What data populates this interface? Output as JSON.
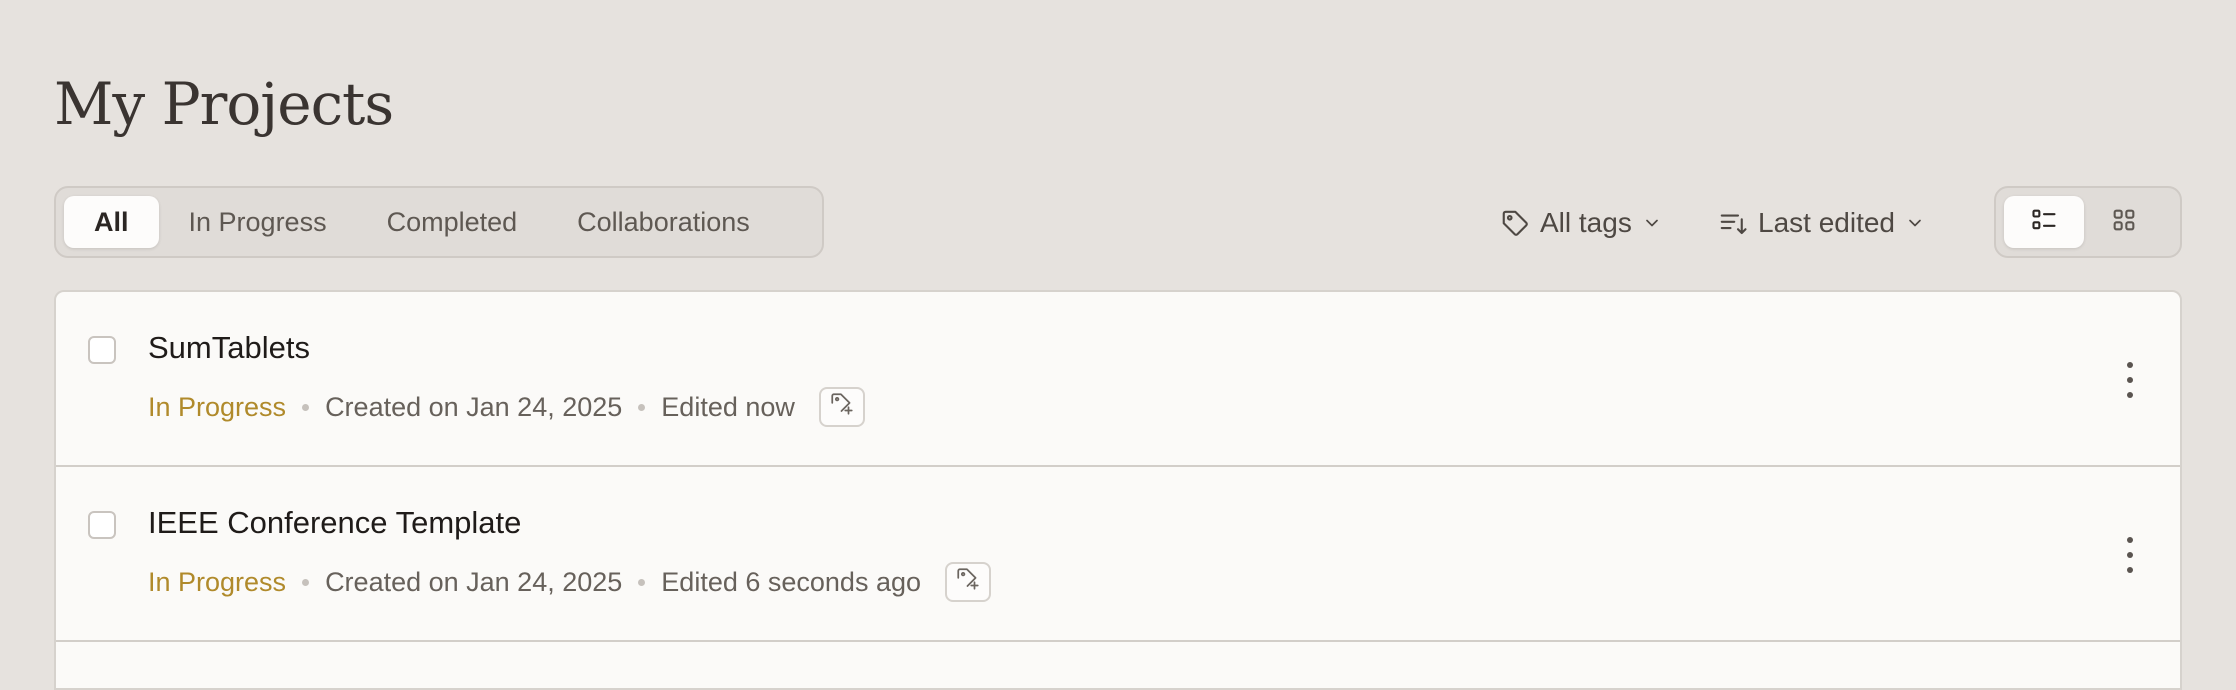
{
  "page": {
    "title": "My Projects"
  },
  "tabs": [
    {
      "label": "All",
      "active": true
    },
    {
      "label": "In Progress",
      "active": false
    },
    {
      "label": "Completed",
      "active": false
    },
    {
      "label": "Collaborations",
      "active": false
    }
  ],
  "filters": {
    "tags_label": "All tags",
    "sort_label": "Last edited"
  },
  "view_toggle": {
    "active": "list"
  },
  "projects": [
    {
      "title": "SumTablets",
      "status": "In Progress",
      "created": "Created on Jan 24, 2025",
      "edited": "Edited now"
    },
    {
      "title": "IEEE Conference Template",
      "status": "In Progress",
      "created": "Created on Jan 24, 2025",
      "edited": "Edited 6 seconds ago"
    }
  ],
  "colors": {
    "background": "#e6e2de",
    "status_in_progress": "#b08a2b",
    "card": "#fbfaf8"
  }
}
